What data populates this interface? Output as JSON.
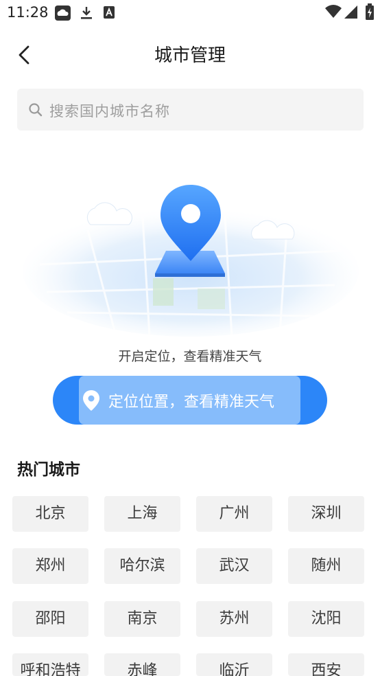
{
  "status_bar": {
    "time": "11:28"
  },
  "header": {
    "title": "城市管理"
  },
  "search": {
    "placeholder": "搜索国内城市名称"
  },
  "location": {
    "caption": "开启定位，查看精准天气",
    "button_label": "定位位置，查看精准天气"
  },
  "hot": {
    "title": "热门城市",
    "cities": [
      "北京",
      "上海",
      "广州",
      "深圳",
      "郑州",
      "哈尔滨",
      "武汉",
      "随州",
      "邵阳",
      "南京",
      "苏州",
      "沈阳",
      "呼和浩特",
      "赤峰",
      "临沂",
      "西安"
    ]
  },
  "colors": {
    "accent": "#2c86f8",
    "accent_light": "#86bcfb",
    "chip_bg": "#f2f2f2"
  }
}
